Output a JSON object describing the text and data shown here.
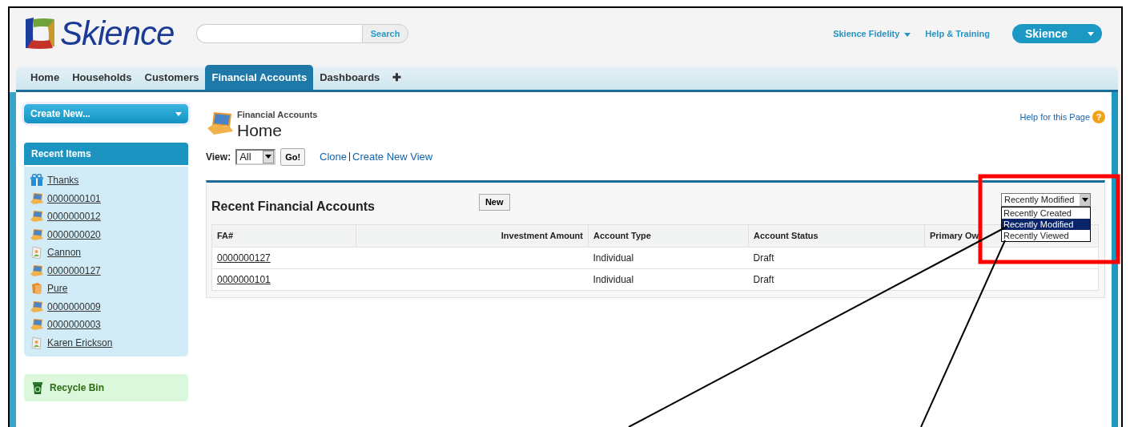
{
  "header": {
    "logo_text": "Skience",
    "search": {
      "button": "Search"
    },
    "links": [
      {
        "label": "Skience Fidelity",
        "dropdown": true
      },
      {
        "label": "Help & Training",
        "dropdown": false
      }
    ],
    "user_menu": "Skience"
  },
  "tabs": [
    {
      "label": "Home",
      "selected": false
    },
    {
      "label": "Households",
      "selected": false
    },
    {
      "label": "Customers",
      "selected": false
    },
    {
      "label": "Financial Accounts",
      "selected": true
    },
    {
      "label": "Dashboards",
      "selected": false
    },
    {
      "label": "✚",
      "selected": false
    }
  ],
  "sidebar": {
    "create_new": "Create New...",
    "recent_title": "Recent Items",
    "items": [
      {
        "label": "Thanks",
        "kind": "gift"
      },
      {
        "label": "0000000101",
        "kind": "laptop"
      },
      {
        "label": "0000000012",
        "kind": "laptop"
      },
      {
        "label": "0000000020",
        "kind": "laptop"
      },
      {
        "label": "Cannon",
        "kind": "person"
      },
      {
        "label": "0000000127",
        "kind": "laptop"
      },
      {
        "label": "Pure",
        "kind": "folder"
      },
      {
        "label": "0000000009",
        "kind": "laptop"
      },
      {
        "label": "0000000003",
        "kind": "laptop"
      },
      {
        "label": "Karen Erickson",
        "kind": "person"
      }
    ],
    "recycle_bin": "Recycle Bin"
  },
  "page": {
    "breadcrumb": "Financial Accounts",
    "title": "Home",
    "help_link": "Help for this Page",
    "help_icon": "?",
    "view_label": "View:",
    "view_value": "All",
    "go_button": "Go!",
    "links": [
      "Clone",
      "Create New View"
    ]
  },
  "recent": {
    "title": "Recent Financial Accounts",
    "new_button": "New",
    "sort": {
      "value": "Recently Modified",
      "options": [
        {
          "label": "Recently Created",
          "selected": false
        },
        {
          "label": "Recently Modified",
          "selected": true
        },
        {
          "label": "Recently Viewed",
          "selected": false
        }
      ]
    },
    "columns": [
      "FA#",
      "Investment Amount",
      "Account Type",
      "Account Status",
      "Primary Ow"
    ],
    "rows": [
      {
        "fa": "0000000127",
        "type": "Individual",
        "status": "Draft"
      },
      {
        "fa": "0000000101",
        "type": "Individual",
        "status": "Draft"
      }
    ]
  }
}
